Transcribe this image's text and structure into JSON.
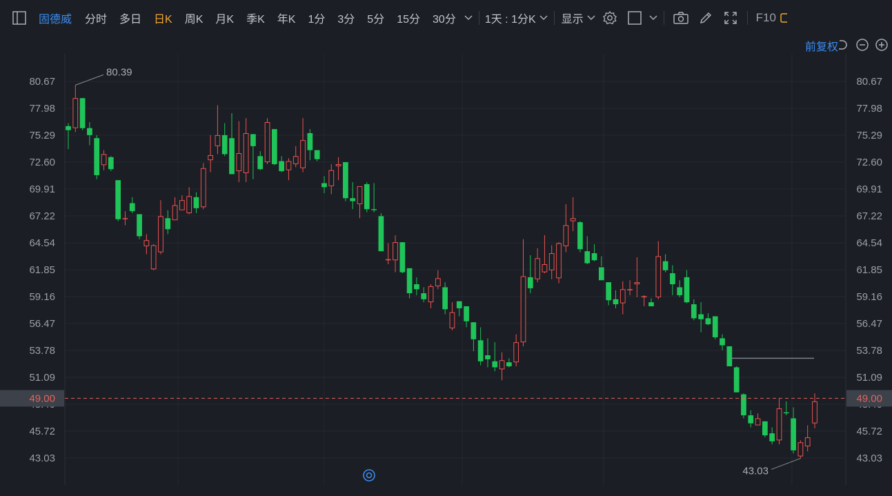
{
  "toolbar": {
    "stock_name": "固德威",
    "periods": [
      "分时",
      "多日",
      "日K",
      "周K",
      "月K",
      "季K",
      "年K",
      "1分",
      "3分",
      "5分",
      "15分",
      "30分"
    ],
    "active_period": "日K",
    "interval_selector": "1天 : 1分K",
    "display_label": "显示",
    "f10_label": "F10"
  },
  "subbar": {
    "adjust_label": "前复权"
  },
  "colors": {
    "up": "#ef5350",
    "down": "#1fc559",
    "accent_blue": "#3b8cf2",
    "active_orange": "#f0a531",
    "price_line": "#e8625c"
  },
  "icons": [
    "sidebar-toggle-icon",
    "chevron-down-icon",
    "settings-gear-icon",
    "square-checkbox-icon",
    "camera-icon",
    "pencil-icon",
    "fullscreen-icon",
    "undo-icon",
    "minus-circle-icon",
    "target-icon"
  ],
  "chart_data": {
    "type": "candlestick",
    "y_ticks": [
      "80.67",
      "77.98",
      "75.29",
      "72.60",
      "69.91",
      "67.22",
      "64.54",
      "61.85",
      "59.16",
      "56.47",
      "53.78",
      "51.09",
      "48.40",
      "45.72",
      "43.03"
    ],
    "ylim": [
      43.03,
      80.67
    ],
    "current_price": "49.00",
    "max_label": "80.39",
    "min_label": "43.03",
    "candles": [
      [
        76.2,
        76.5,
        73.9,
        75.8
      ],
      [
        76.0,
        80.3,
        75.6,
        79.0
      ],
      [
        79.0,
        79.0,
        75.8,
        76.0
      ],
      [
        76.0,
        76.6,
        74.3,
        75.3
      ],
      [
        75.0,
        75.3,
        70.9,
        71.3
      ],
      [
        72.3,
        73.8,
        71.8,
        73.4
      ],
      [
        73.1,
        73.2,
        71.7,
        71.9
      ],
      [
        70.8,
        70.8,
        66.7,
        66.9
      ],
      [
        66.9,
        67.7,
        66.3,
        67.0
      ],
      [
        68.5,
        69.1,
        67.5,
        67.7
      ],
      [
        67.4,
        67.4,
        64.9,
        65.2
      ],
      [
        64.2,
        65.4,
        63.4,
        64.8
      ],
      [
        61.9,
        64.4,
        61.8,
        64.3
      ],
      [
        63.6,
        68.8,
        63.4,
        67.2
      ],
      [
        67.0,
        67.8,
        65.4,
        65.9
      ],
      [
        66.8,
        69.1,
        66.8,
        68.3
      ],
      [
        67.8,
        69.3,
        67.8,
        68.8
      ],
      [
        67.5,
        70.1,
        67.4,
        69.2
      ],
      [
        69.1,
        69.6,
        67.5,
        68.0
      ],
      [
        68.1,
        72.5,
        67.9,
        72.0
      ],
      [
        72.8,
        75.3,
        71.6,
        73.3
      ],
      [
        74.2,
        78.3,
        73.4,
        75.3
      ],
      [
        75.3,
        76.5,
        73.2,
        73.4
      ],
      [
        75.0,
        77.5,
        72.8,
        71.4
      ],
      [
        71.7,
        76.7,
        70.6,
        73.5
      ],
      [
        71.5,
        77.0,
        70.6,
        75.5
      ],
      [
        75.4,
        75.4,
        70.9,
        74.2
      ],
      [
        73.2,
        73.7,
        71.8,
        71.9
      ],
      [
        72.6,
        77.0,
        72.4,
        76.6
      ],
      [
        75.9,
        75.9,
        72.3,
        72.4
      ],
      [
        72.7,
        73.2,
        71.6,
        71.7
      ],
      [
        71.8,
        73.0,
        70.8,
        72.7
      ],
      [
        72.4,
        74.2,
        72.1,
        73.2
      ],
      [
        72.0,
        77.0,
        71.6,
        74.8
      ],
      [
        75.5,
        75.9,
        72.8,
        73.8
      ],
      [
        73.8,
        73.8,
        72.7,
        72.9
      ],
      [
        70.5,
        71.2,
        69.5,
        70.1
      ],
      [
        70.2,
        72.4,
        69.4,
        71.8
      ],
      [
        72.2,
        73.1,
        70.8,
        72.4
      ],
      [
        72.6,
        72.6,
        68.7,
        69.0
      ],
      [
        69.0,
        70.6,
        67.9,
        68.7
      ],
      [
        68.4,
        69.6,
        67.0,
        70.2
      ],
      [
        70.4,
        70.6,
        67.6,
        67.9
      ],
      [
        67.9,
        70.5,
        67.6,
        67.8
      ],
      [
        67.2,
        67.5,
        63.7,
        63.7
      ],
      [
        62.9,
        64.5,
        62.4,
        62.9
      ],
      [
        62.8,
        65.3,
        61.6,
        64.6
      ],
      [
        64.6,
        64.6,
        61.5,
        61.6
      ],
      [
        62.0,
        62.0,
        59.0,
        59.5
      ],
      [
        60.4,
        61.1,
        59.3,
        59.9
      ],
      [
        59.5,
        60.1,
        58.6,
        58.9
      ],
      [
        58.6,
        60.4,
        58.0,
        60.2
      ],
      [
        60.2,
        61.8,
        59.9,
        61.0
      ],
      [
        60.1,
        60.6,
        57.4,
        57.9
      ],
      [
        56.0,
        58.6,
        55.8,
        57.6
      ],
      [
        58.7,
        58.7,
        57.2,
        58.0
      ],
      [
        58.2,
        58.2,
        56.1,
        56.7
      ],
      [
        56.6,
        56.6,
        53.7,
        54.9
      ],
      [
        54.8,
        56.1,
        52.3,
        52.7
      ],
      [
        53.3,
        55.0,
        52.1,
        52.9
      ],
      [
        52.7,
        54.6,
        51.7,
        52.1
      ],
      [
        51.9,
        53.6,
        50.8,
        52.8
      ],
      [
        52.6,
        53.0,
        52.1,
        52.2
      ],
      [
        52.6,
        55.4,
        52.2,
        54.6
      ],
      [
        54.6,
        64.9,
        54.2,
        61.2
      ],
      [
        61.1,
        63.3,
        59.5,
        60.0
      ],
      [
        60.9,
        64.0,
        60.6,
        63.0
      ],
      [
        61.6,
        65.3,
        61.5,
        62.4
      ],
      [
        61.8,
        64.3,
        60.9,
        63.5
      ],
      [
        61.0,
        64.6,
        60.5,
        64.5
      ],
      [
        64.2,
        68.4,
        63.6,
        66.3
      ],
      [
        66.7,
        69.1,
        65.7,
        67.0
      ],
      [
        66.6,
        66.7,
        63.6,
        63.9
      ],
      [
        63.7,
        65.2,
        62.4,
        62.5
      ],
      [
        63.5,
        64.4,
        62.7,
        62.8
      ],
      [
        62.1,
        63.2,
        62.2,
        60.8
      ],
      [
        60.6,
        60.6,
        58.3,
        58.8
      ],
      [
        58.9,
        59.8,
        58.0,
        58.4
      ],
      [
        58.5,
        60.7,
        57.4,
        59.9
      ],
      [
        59.8,
        60.8,
        59.3,
        59.9
      ],
      [
        60.4,
        63.1,
        59.1,
        60.6
      ],
      [
        59.1,
        59.3,
        58.2,
        59.2
      ],
      [
        58.6,
        59.0,
        58.2,
        58.2
      ],
      [
        59.1,
        64.7,
        58.9,
        63.2
      ],
      [
        62.7,
        63.4,
        61.6,
        61.8
      ],
      [
        61.5,
        62.3,
        59.3,
        60.4
      ],
      [
        60.1,
        60.8,
        59.1,
        59.3
      ],
      [
        61.1,
        61.8,
        58.5,
        58.6
      ],
      [
        58.4,
        58.9,
        56.8,
        57.0
      ],
      [
        57.4,
        58.6,
        55.6,
        56.9
      ],
      [
        57.0,
        57.5,
        56.3,
        56.4
      ],
      [
        57.2,
        57.2,
        54.9,
        55.1
      ],
      [
        55.0,
        55.4,
        53.8,
        54.3
      ],
      [
        54.2,
        54.2,
        52.2,
        52.2
      ],
      [
        52.1,
        52.2,
        49.6,
        49.6
      ],
      [
        49.4,
        49.5,
        47.0,
        47.3
      ],
      [
        47.3,
        47.8,
        46.1,
        46.5
      ],
      [
        46.3,
        47.5,
        46.4,
        47.0
      ],
      [
        46.7,
        46.7,
        45.1,
        45.3
      ],
      [
        45.5,
        46.1,
        44.4,
        44.7
      ],
      [
        44.8,
        49.0,
        44.4,
        48.0
      ],
      [
        47.6,
        48.7,
        47.3,
        47.5
      ],
      [
        47.0,
        48.1,
        43.5,
        43.8
      ],
      [
        43.2,
        44.8,
        43.0,
        44.6
      ],
      [
        44.2,
        46.3,
        43.7,
        45.1
      ],
      [
        46.5,
        49.5,
        46.0,
        48.7
      ]
    ]
  }
}
